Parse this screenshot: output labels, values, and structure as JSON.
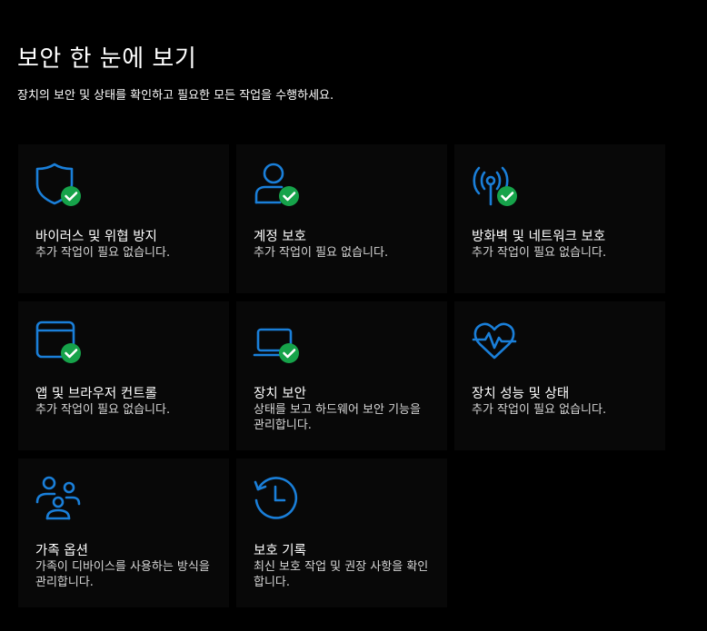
{
  "page": {
    "title": "보안 한 눈에 보기",
    "subtitle": "장치의 보안 및 상태를 확인하고 필요한 모든 작업을 수행하세요."
  },
  "colors": {
    "accent": "#1a7fd9",
    "ok_badge": "#16a34a",
    "tile_bg": "#080808",
    "background": "#000000"
  },
  "tiles": [
    {
      "icon": "shield-icon",
      "title": "바이러스 및 위협 방지",
      "desc": "추가 작업이 필요 없습니다.",
      "status": "ok"
    },
    {
      "icon": "account-icon",
      "title": "계정 보호",
      "desc": "추가 작업이 필요 없습니다.",
      "status": "ok"
    },
    {
      "icon": "firewall-antenna-icon",
      "title": "방화벽 및 네트워크 보호",
      "desc": "추가 작업이 필요 없습니다.",
      "status": "ok"
    },
    {
      "icon": "browser-window-icon",
      "title": "앱 및 브라우저 컨트롤",
      "desc": "추가 작업이 필요 없습니다.",
      "status": "ok"
    },
    {
      "icon": "laptop-icon",
      "title": "장치 보안",
      "desc": "상태를 보고 하드웨어 보안 기능을 관리합니다.",
      "status": "ok"
    },
    {
      "icon": "heart-pulse-icon",
      "title": "장치 성능 및 상태",
      "desc": "추가 작업이 필요 없습니다.",
      "status": "none"
    },
    {
      "icon": "family-icon",
      "title": "가족 옵션",
      "desc": "가족이 디바이스를 사용하는 방식을 관리합니다.",
      "status": "none"
    },
    {
      "icon": "history-clock-icon",
      "title": "보호 기록",
      "desc": "최신 보호 작업 및 권장 사항을 확인합니다.",
      "status": "none"
    }
  ]
}
